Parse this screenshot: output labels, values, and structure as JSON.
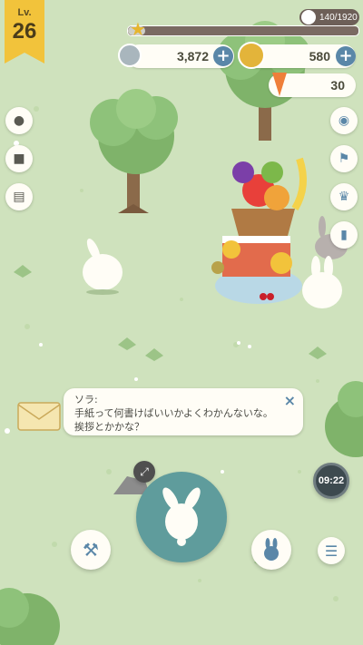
{
  "hud": {
    "level_label": "Lv.",
    "level_value": "26",
    "xp_text": "140/1920",
    "xp_progress": 0.073,
    "coins": "3,872",
    "gold": "580",
    "carrots": "30",
    "timer": "09:22"
  },
  "dialog": {
    "speaker": "ソラ:",
    "line1": "手紙って何書けばいいかよくわかんないな。",
    "line2": "挨拶とかかな？"
  },
  "icons": {
    "side_left": [
      "badge-icon",
      "box-icon",
      "newspaper-icon"
    ],
    "side_right": [
      "camera-icon",
      "flag-icon",
      "trophy-icon",
      "ranking-icon"
    ],
    "bottom": [
      "hammer-icon",
      "rabbit-icon",
      "menu-icon"
    ]
  },
  "colors": {
    "grass": "#cfe2bd",
    "button_blue": "#5a87a8",
    "level_flag": "#f2c33b",
    "primary_button": "#5f9c9c"
  }
}
